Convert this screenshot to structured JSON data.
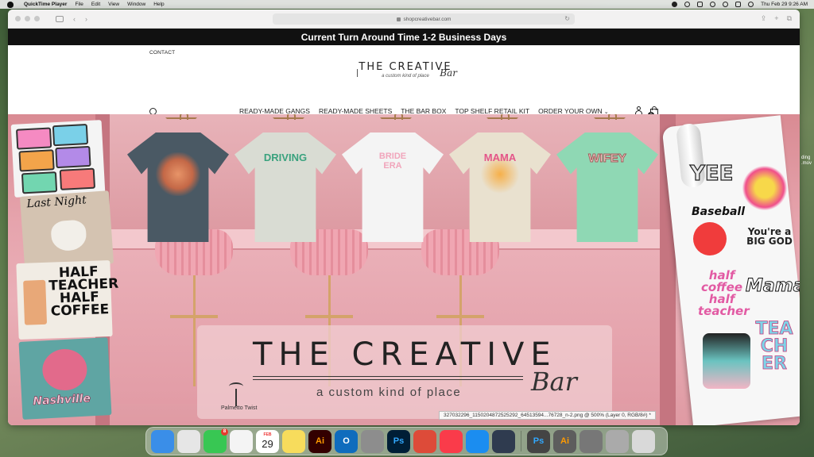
{
  "menubar": {
    "app_name": "QuickTime Player",
    "items": [
      "File",
      "Edit",
      "View",
      "Window",
      "Help"
    ],
    "clock": "Thu Feb 29  9:26 AM"
  },
  "browser": {
    "url": "shopcreativebar.com"
  },
  "site": {
    "announcement": "Current Turn Around Time 1-2 Business Days",
    "contact_label": "CONTACT",
    "logo": {
      "title": "THE CREATIVE",
      "script": "Bar",
      "tagline": "a custom kind of place"
    },
    "nav": [
      {
        "label": "READY-MADE GANGS"
      },
      {
        "label": "READY-MADE SHEETS"
      },
      {
        "label": "THE BAR BOX"
      },
      {
        "label": "TOP SHELF RETAIL KIT"
      },
      {
        "label": "ORDER YOUR OWN"
      }
    ],
    "cart_count": "0"
  },
  "hero": {
    "shirts": [
      {
        "graphic": "",
        "color": "#4a5964"
      },
      {
        "graphic": "DRIVING",
        "color": "#d9dcd3"
      },
      {
        "graphic": "BRIDE ERA",
        "color": "#f4f4f4"
      },
      {
        "graphic": "MAMA",
        "color": "#e9e1cf"
      },
      {
        "graphic": "WIFEY",
        "color": "#8fd8b4"
      }
    ],
    "left_stickers": {
      "night": "Last Night",
      "teacher": "HALF TEACHER HALF COFFEE",
      "city": "Nashville"
    },
    "roll_stickers": {
      "yee": "YEE",
      "baseball": "Baseball",
      "god": "You're a BIG GOD",
      "half": "half coffee half teacher",
      "mama": "Mama",
      "teacher": "TEACHER"
    },
    "overlay": {
      "title": "THE CREATIVE",
      "script": "Bar",
      "tagline": "a custom kind of place",
      "brand": "Palmetto Twist"
    }
  },
  "tooltip": "327032296_1150204872525292_64513594...76728_n-2.png @ 500% (Layer 0, RGB/8#) *",
  "desktop_file": "ding\n.mov",
  "dock": [
    {
      "name": "finder-icon",
      "label": "",
      "color": "#3a8ee8"
    },
    {
      "name": "launchpad-icon",
      "label": "",
      "color": "#e6e6e6"
    },
    {
      "name": "messages-icon",
      "label": "",
      "color": "#38c753",
      "badge": "8"
    },
    {
      "name": "photos-icon",
      "label": "",
      "color": "#f4f4f4"
    },
    {
      "name": "calendar-icon",
      "label": "29",
      "month": "FEB",
      "color": "#ffffff"
    },
    {
      "name": "notes-icon",
      "label": "",
      "color": "#f7dc5c"
    },
    {
      "name": "illustrator-icon",
      "label": "Ai",
      "color": "#330000"
    },
    {
      "name": "outlook-icon",
      "label": "O",
      "color": "#0f6cbd"
    },
    {
      "name": "system-settings-icon",
      "label": "",
      "color": "#8d8d8d"
    },
    {
      "name": "photoshop-icon",
      "label": "Ps",
      "color": "#001e36"
    },
    {
      "name": "chrome-icon",
      "label": "",
      "color": "#dd4b39"
    },
    {
      "name": "news-icon",
      "label": "",
      "color": "#fa3b4a"
    },
    {
      "name": "safari-icon",
      "label": "",
      "color": "#1b8df0"
    },
    {
      "name": "quicktime-icon",
      "label": "",
      "color": "#2f3b4f"
    },
    {
      "name": "recent-photoshop-icon",
      "label": "Ps",
      "color": "#444"
    },
    {
      "name": "recent-illustrator-icon",
      "label": "Ai",
      "color": "#5d5d5d"
    },
    {
      "name": "recent-window-1-icon",
      "label": "",
      "color": "#777"
    },
    {
      "name": "recent-window-2-icon",
      "label": "",
      "color": "#aaa"
    },
    {
      "name": "trash-icon",
      "label": "",
      "color": "#d9d9d9"
    }
  ]
}
